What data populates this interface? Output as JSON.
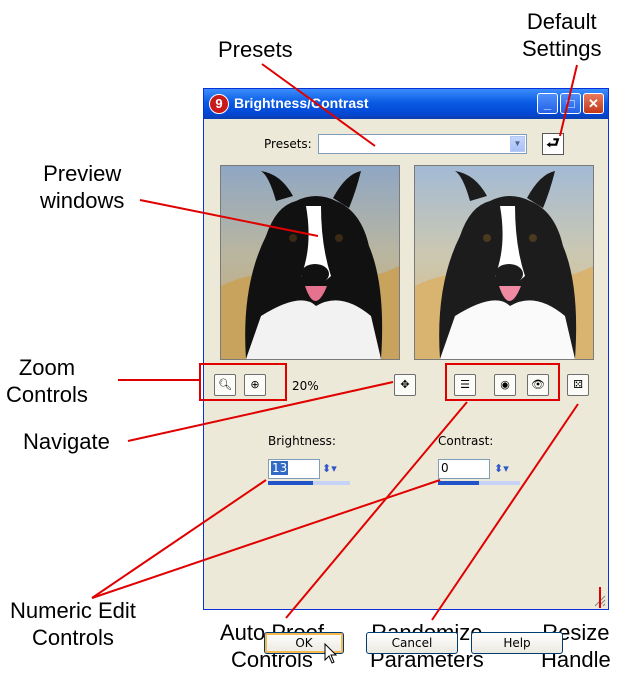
{
  "window": {
    "title": "Brightness/Contrast",
    "app_icon_text": "9",
    "controls": {
      "minimize": "_",
      "maximize": "□",
      "close": "✕"
    }
  },
  "presets": {
    "label": "Presets:",
    "value": ""
  },
  "zoom": {
    "level": "20%"
  },
  "brightness": {
    "label": "Brightness:",
    "value": "13",
    "fill": 0.55
  },
  "contrast": {
    "label": "Contrast:",
    "value": "0",
    "fill": 0.5
  },
  "buttons": {
    "ok": "OK",
    "cancel": "Cancel",
    "help": "Help"
  },
  "callouts": {
    "presets": "Presets",
    "default_settings": [
      "Default",
      "Settings"
    ],
    "preview_windows": [
      "Preview",
      "windows"
    ],
    "zoom_controls": [
      "Zoom",
      "Controls"
    ],
    "navigate": "Navigate",
    "numeric_edit": [
      "Numeric Edit",
      "Controls"
    ],
    "auto_proof": [
      "Auto Proof",
      "Controls"
    ],
    "randomize": [
      "Randomize",
      "Parameters"
    ],
    "resize_handle": [
      "Resize",
      "Handle"
    ]
  },
  "colors": {
    "callout_line": "#e00000",
    "title_bar": "#0a5be3",
    "dialog_bg": "#ece9d8"
  },
  "icons": [
    "zoom-out-icon",
    "zoom-in-icon",
    "navigate-icon",
    "auto-proof-icon",
    "proof-icon",
    "preview-eye-icon",
    "randomize-dice-icon",
    "default-settings-icon",
    "resize-grip-icon"
  ]
}
